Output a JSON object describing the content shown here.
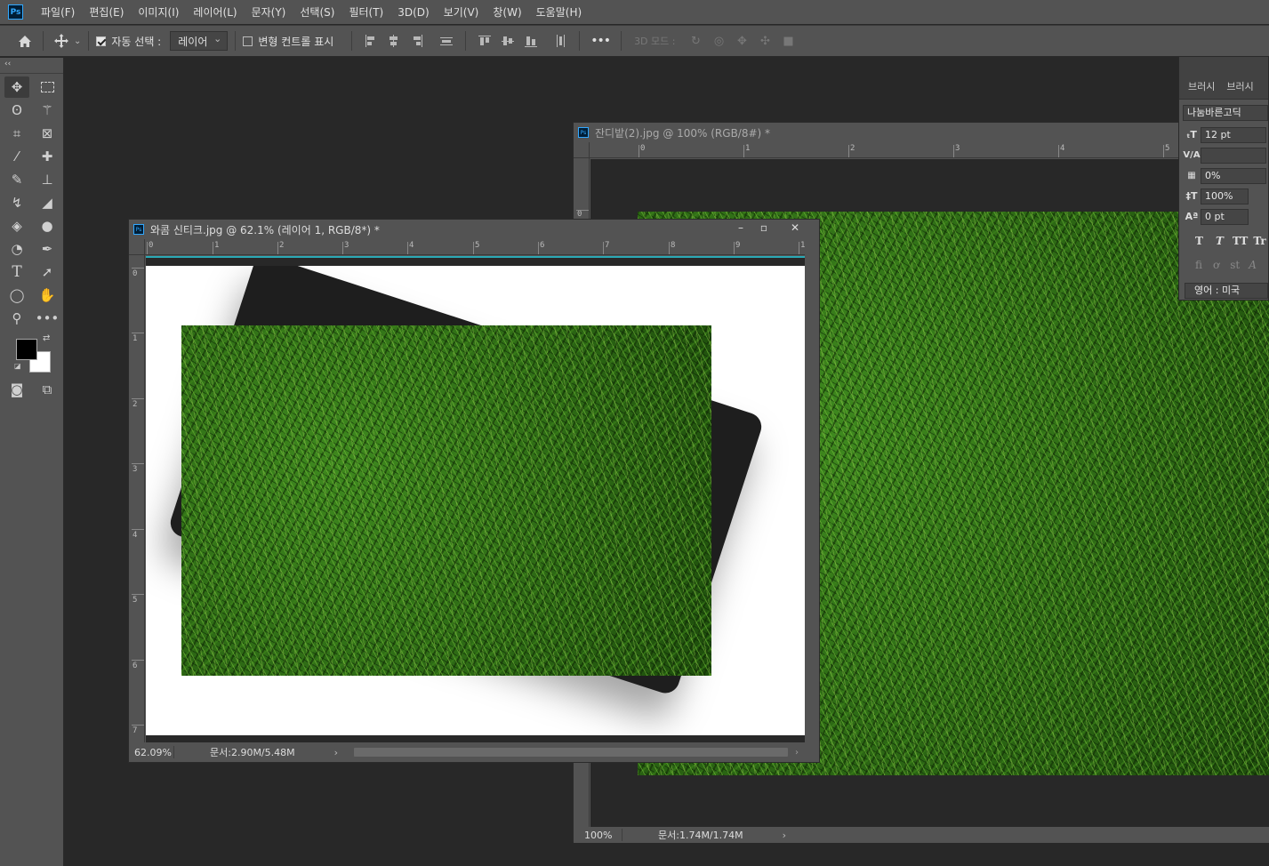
{
  "app": {
    "logo": "Ps"
  },
  "menu": [
    "파일(F)",
    "편집(E)",
    "이미지(I)",
    "레이어(L)",
    "문자(Y)",
    "선택(S)",
    "필터(T)",
    "3D(D)",
    "보기(V)",
    "창(W)",
    "도움말(H)"
  ],
  "options": {
    "auto_select_label": "자동 선택 :",
    "auto_select_value": "레이어",
    "transform_label": "변형 컨트롤 표시",
    "more": "•••",
    "three_d_label": "3D 모드 :"
  },
  "tools_panel": {
    "collapse": "‹‹"
  },
  "doc_front": {
    "title": "와콤 신티크.jpg @ 62.1% (레이어 1, RGB/8*) *",
    "zoom": "62.09%",
    "doc_size": "문서:2.90M/5.48M",
    "ruler_h": [
      "0",
      "1",
      "2",
      "3",
      "4",
      "5",
      "6",
      "7",
      "8",
      "9",
      "1"
    ],
    "ruler_v": [
      "0",
      "1",
      "2",
      "3",
      "4",
      "5",
      "6",
      "7"
    ],
    "btn_min": "–",
    "btn_max": "▫",
    "btn_close": "✕"
  },
  "doc_back": {
    "title": "잔디밭(2).jpg @ 100% (RGB/8#) *",
    "zoom": "100%",
    "doc_size": "문서:1.74M/1.74M",
    "ruler_h": [
      "0",
      "1",
      "2",
      "3",
      "4",
      "5"
    ],
    "ruler_v": [
      "0"
    ]
  },
  "char_panel": {
    "tab1": "브러시",
    "tab2": "브러시",
    "font": "나눔바른고딕",
    "size": "12 pt",
    "kerning": "",
    "tracking": "0%",
    "vscale": "100%",
    "baseline": "0 pt",
    "language": "영어 : 미국",
    "style_buttons": [
      "T",
      "T",
      "TT",
      "Tr"
    ],
    "opentype_buttons": [
      "fi",
      "ơ",
      "st",
      "A"
    ]
  }
}
